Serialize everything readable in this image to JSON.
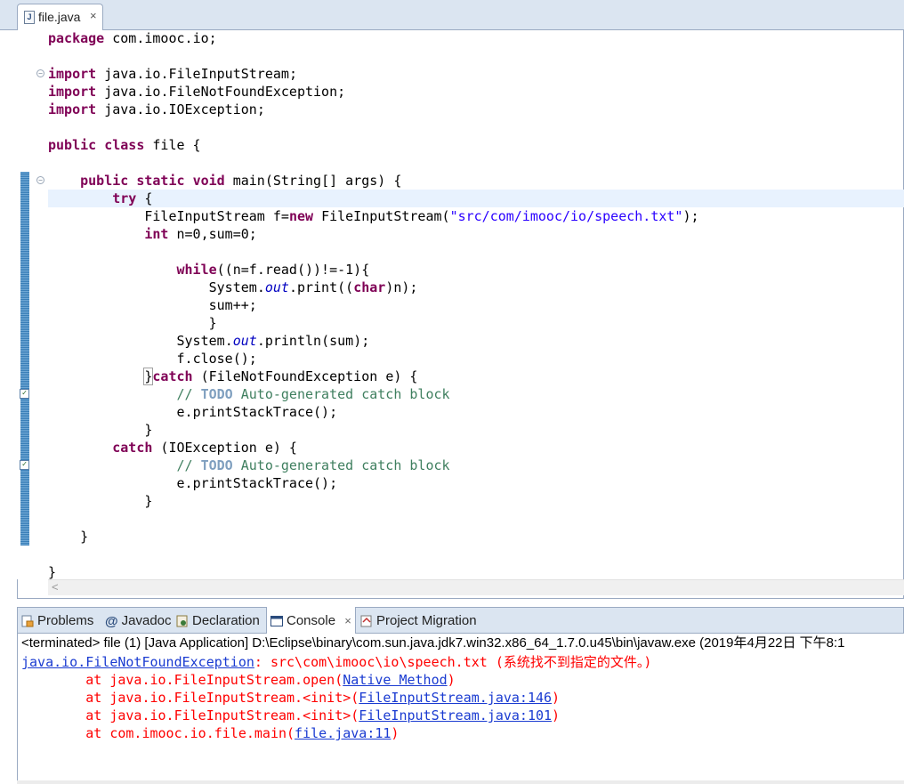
{
  "editor_tab": {
    "label": "file.java",
    "close": "×",
    "icon": "java-file-icon"
  },
  "code_lines": [
    "package com.imooc.io;",
    "",
    "import java.io.FileInputStream;",
    "import java.io.FileNotFoundException;",
    "import java.io.IOException;",
    "",
    "public class file {",
    "",
    "    public static void main(String[] args) {",
    "        try {",
    "            FileInputStream f=new FileInputStream(\"src/com/imooc/io/speech.txt\");",
    "            int n=0,sum=0;",
    "",
    "                while((n=f.read())!=-1){",
    "                    System.out.print((char)n);",
    "                    sum++;",
    "                    }",
    "                System.out.println(sum);",
    "                f.close();",
    "            }catch (FileNotFoundException e) {",
    "                // TODO Auto-generated catch block",
    "                e.printStackTrace();",
    "            }",
    "        catch (IOException e) {",
    "                // TODO Auto-generated catch block",
    "                e.printStackTrace();",
    "            }",
    "",
    "    }",
    "",
    "}"
  ],
  "panel_tabs": [
    {
      "label": "Problems",
      "icon": "problems-icon",
      "active": false
    },
    {
      "label": "Javadoc",
      "icon": "at-icon",
      "active": false
    },
    {
      "label": "Declaration",
      "icon": "declaration-icon",
      "active": false
    },
    {
      "label": "Console",
      "icon": "console-icon",
      "active": true,
      "close": "×"
    },
    {
      "label": "Project Migration",
      "icon": "migration-icon",
      "active": false
    }
  ],
  "console": {
    "header": "<terminated> file (1) [Java Application] D:\\Eclipse\\binary\\com.sun.java.jdk7.win32.x86_64_1.7.0.u45\\bin\\javaw.exe (2019年4月22日 下午8:1",
    "exception_class": "java.io.FileNotFoundException",
    "exception_message": ": src\\com\\imooc\\io\\speech.txt (系统找不到指定的文件。)",
    "stack": [
      {
        "prefix": "        at java.io.FileInputStream.open(",
        "link": "Native Method",
        "suffix": ")"
      },
      {
        "prefix": "        at java.io.FileInputStream.<init>(",
        "link": "FileInputStream.java:146",
        "suffix": ")"
      },
      {
        "prefix": "        at java.io.FileInputStream.<init>(",
        "link": "FileInputStream.java:101",
        "suffix": ")"
      },
      {
        "prefix": "        at com.imooc.io.file.main(",
        "link": "file.java:11",
        "suffix": ")"
      }
    ]
  },
  "colors": {
    "keyword": "#7f0055",
    "string": "#2a00ff",
    "comment": "#3f7f5f",
    "error": "#ff0000",
    "link": "#1a3bd1",
    "tab_bg": "#dbe5f1"
  }
}
